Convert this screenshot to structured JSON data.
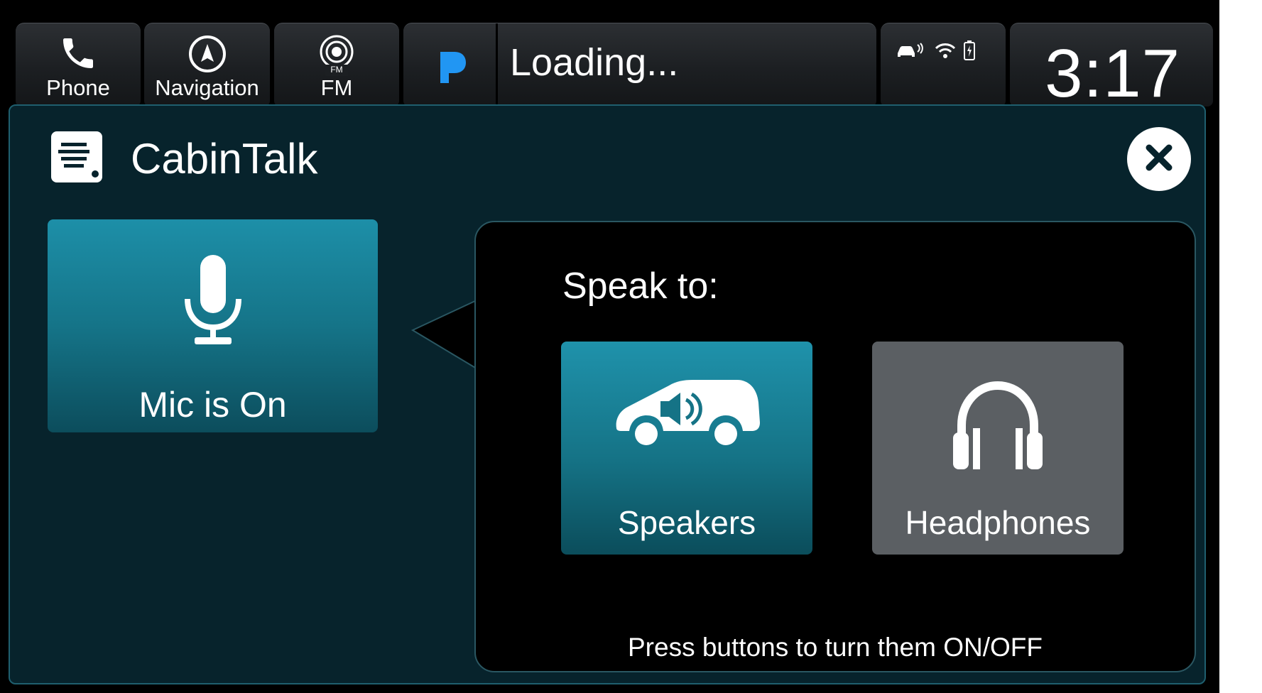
{
  "topbar": {
    "phone_label": "Phone",
    "navigation_label": "Navigation",
    "fm_label": "FM",
    "fm_icon_text": "FM",
    "media_title": "Loading...",
    "clock": "3:17"
  },
  "panel": {
    "title": "CabinTalk",
    "mic_label": "Mic is On",
    "speak_to": "Speak to:",
    "options": [
      {
        "label": "Speakers",
        "icon": "car-speaker-icon"
      },
      {
        "label": "Headphones",
        "icon": "headphones-icon"
      }
    ],
    "hint": "Press buttons to turn them ON/OFF"
  },
  "colors": {
    "accent_teal": "#1d8fa8",
    "panel_bg": "#07232c",
    "inactive_gray": "#5b5f63",
    "pandora_blue": "#2196f3"
  }
}
